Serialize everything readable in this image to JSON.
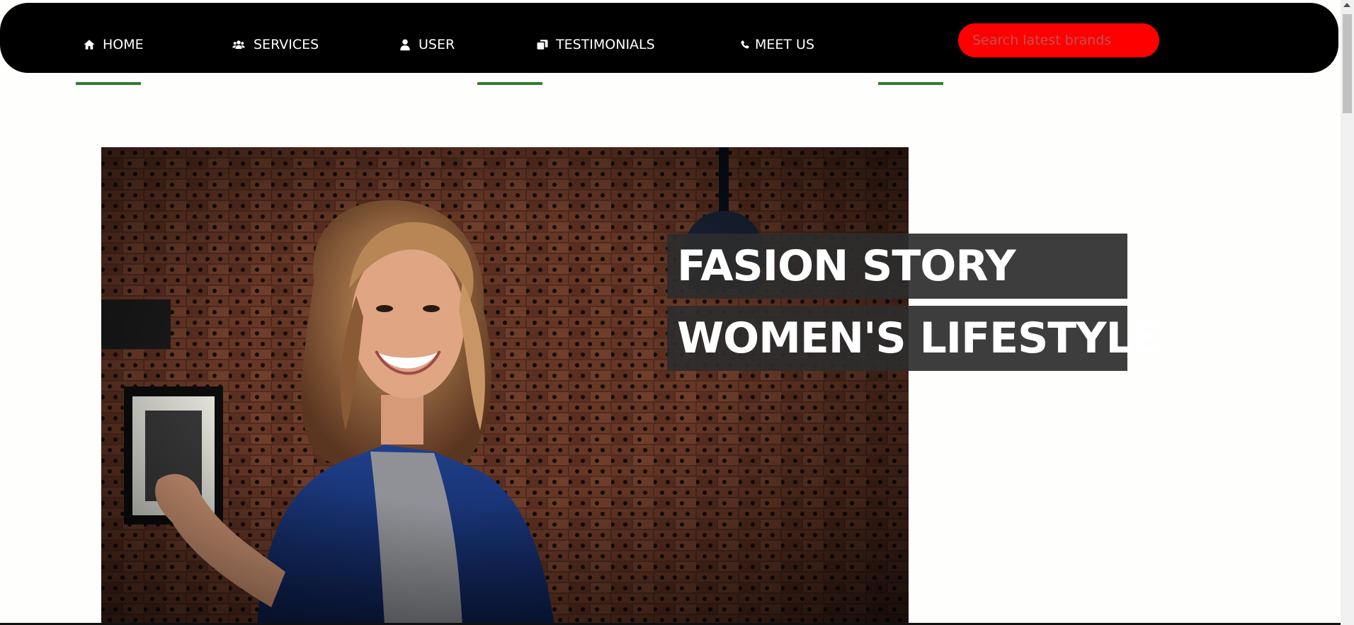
{
  "nav": {
    "items": [
      {
        "label": "HOME",
        "icon": "home-icon"
      },
      {
        "label": "SERVICES",
        "icon": "users-icon"
      },
      {
        "label": "USER",
        "icon": "user-icon"
      },
      {
        "label": "TESTIMONIALS",
        "icon": "clone-icon"
      },
      {
        "label": "MEET US",
        "icon": "phone-icon"
      }
    ],
    "search_placeholder": "Search latest brands",
    "search_value": ""
  },
  "hero": {
    "title_line_1": "FASION STORY",
    "title_line_2": "WOMEN'S LIFESTYLE",
    "image_description_icon": "photo-woman-denim-jacket"
  },
  "colors": {
    "navbar_bg": "#000000",
    "search_bg": "#ff0000",
    "accent_underline": "#2e7d32",
    "title_box_bg": "#2d2d2d",
    "page_bg": "#fefefc"
  }
}
